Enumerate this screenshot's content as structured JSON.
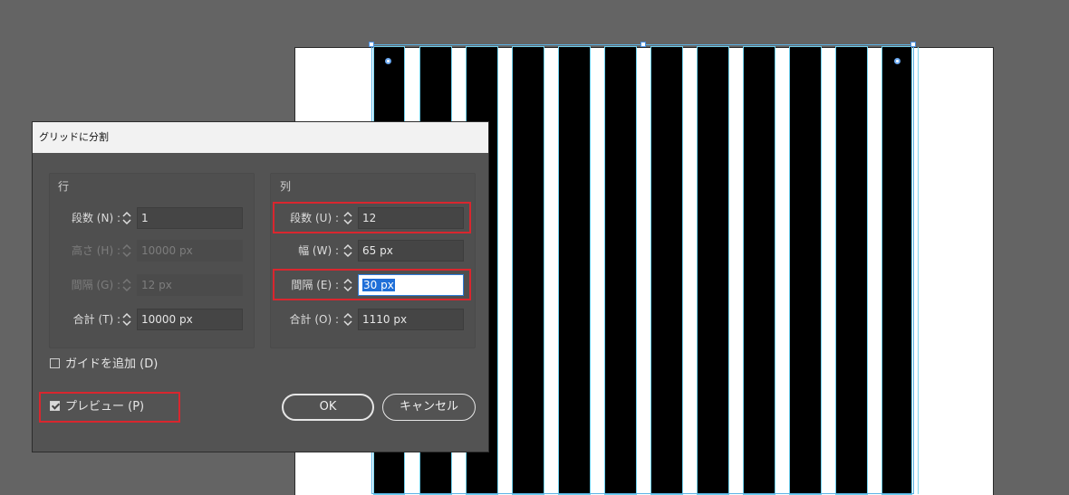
{
  "dialog": {
    "title": "グリッドに分割",
    "rows_group": {
      "title": "行",
      "count": {
        "label": "段数 (N) :",
        "value": "1"
      },
      "height": {
        "label": "高さ (H) :",
        "value": "10000 px"
      },
      "gutter": {
        "label": "間隔 (G) :",
        "value": "12 px"
      },
      "total": {
        "label": "合計 (T) :",
        "value": "10000 px"
      }
    },
    "columns_group": {
      "title": "列",
      "count": {
        "label": "段数 (U) :",
        "value": "12"
      },
      "width": {
        "label": "幅 (W) :",
        "value": "65 px"
      },
      "gutter": {
        "label": "間隔 (E) :",
        "value": "30 px"
      },
      "total": {
        "label": "合計 (O) :",
        "value": "1110 px"
      }
    },
    "add_guides": {
      "label": "ガイドを追加 (D)",
      "checked": false
    },
    "preview": {
      "label": "プレビュー (P)",
      "checked": true
    },
    "ok_label": "OK",
    "cancel_label": "キャンセル"
  },
  "colors": {
    "canvas_bg": "#646464",
    "dialog_bg": "#535353",
    "highlight": "#d9262e",
    "selection": "#5ab4e6"
  },
  "icons": [
    "spinner-icon",
    "checkbox-icon",
    "handle-icon"
  ]
}
